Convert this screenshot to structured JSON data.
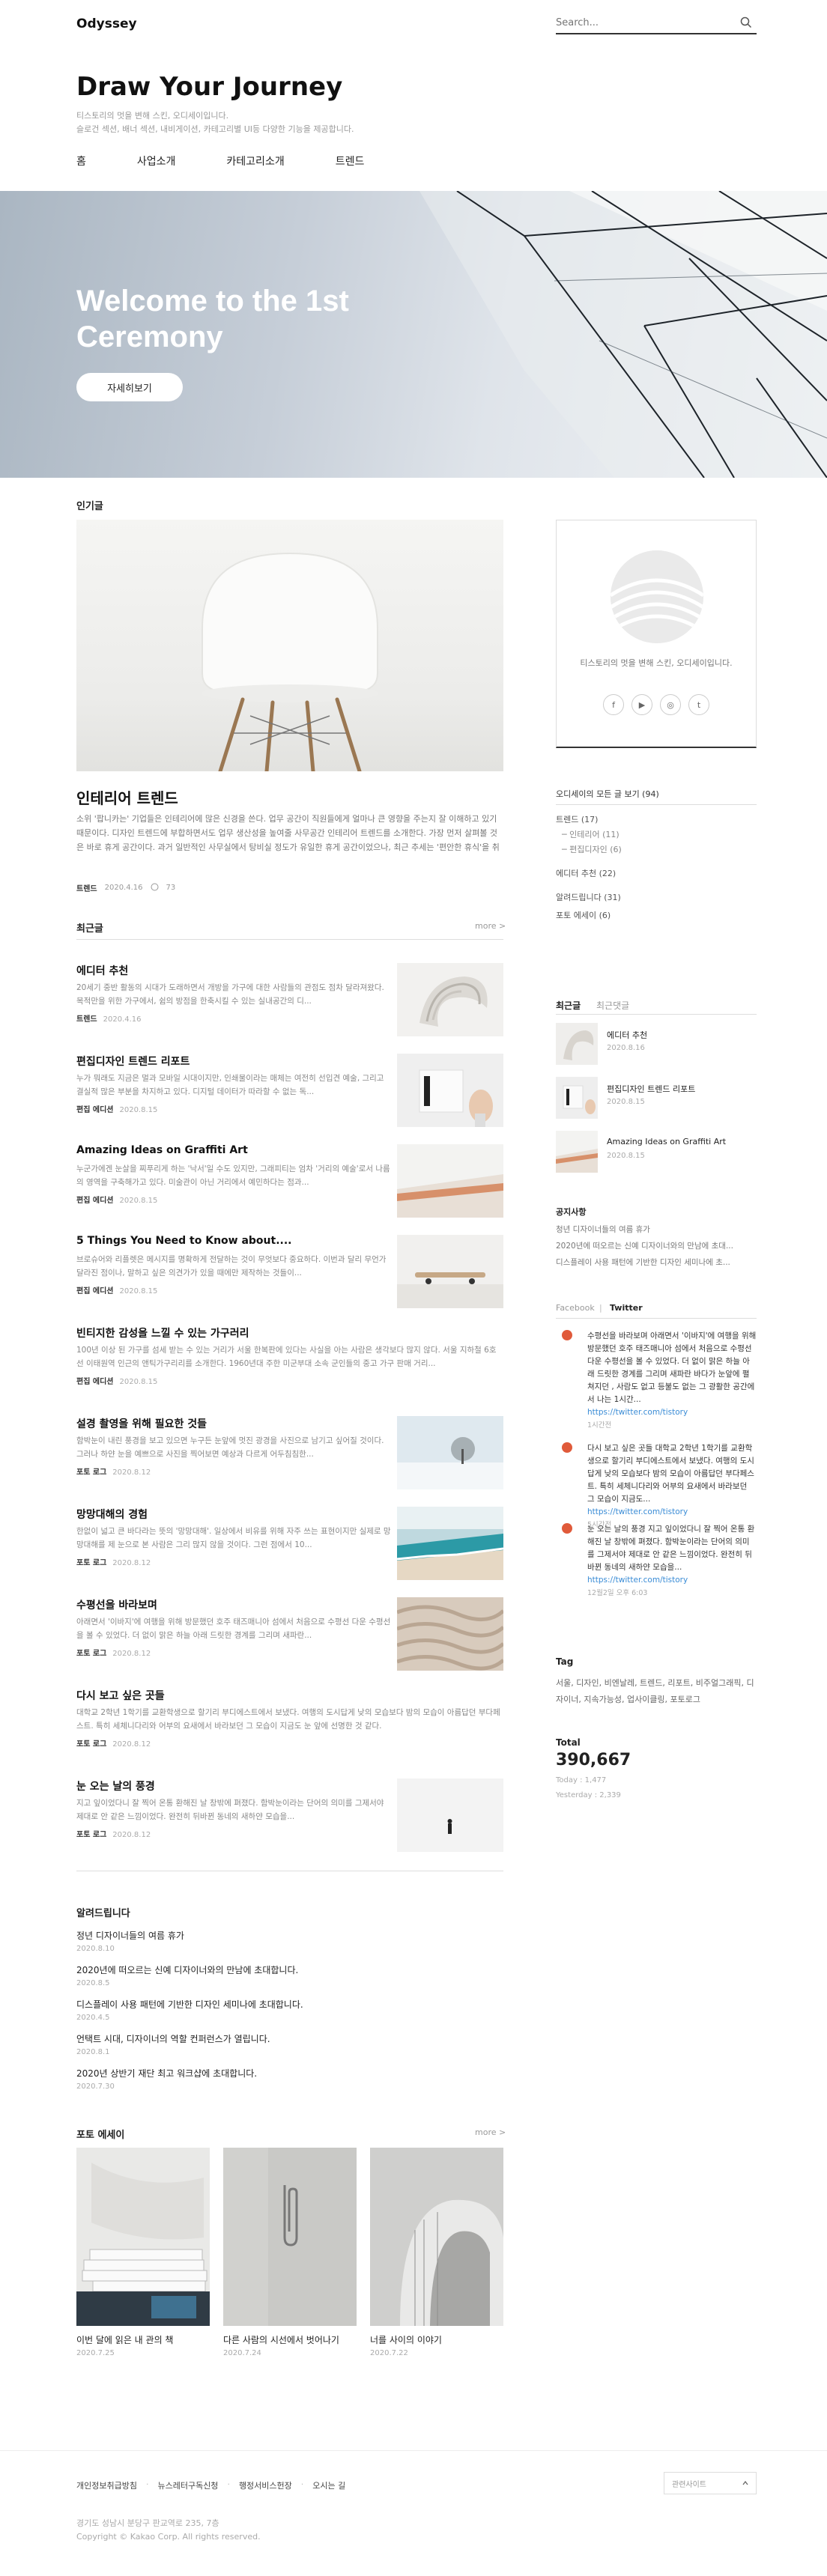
{
  "header": {
    "logo": "Odyssey",
    "search_placeholder": "Search...",
    "blog_title": "Draw Your Journey",
    "blog_desc_1": "티스토리의 멋을 변해 스킨, 오디세이입니다.",
    "blog_desc_2": "슬로건 섹션, 배너 섹션, 내비게이션, 카테고리별 UI등 다양한 기능을 제공합니다.",
    "nav": [
      "홈",
      "사업소개",
      "카테고리소개",
      "트렌드"
    ]
  },
  "hero": {
    "title": "Welcome to the 1st Ceremony",
    "button": "자세히보기"
  },
  "popular": {
    "label": "인기글",
    "title": "인테리어 트렌드",
    "excerpt": "소위 '팝니카는' 기업들은 인테리어에 많은 신경을 쓴다. 업무 공간이 직원들에게 얼마나 큰 영향을 주는지 잘 이해하고 있기 때문이다. 디자인 트렌드에 부합하면서도 업무 생산성을 높여줄 사무공간 인테리어 트렌드를 소개한다. 가장 먼저 살펴볼 것은 바로 휴게 공간이다. 과거 일반적인 사무실에서 탕비실 정도가 유일한 휴게 공간이었으나, 최근 추세는 '편안한 휴식'을 취할 수 있는 공간...",
    "category": "트렌드",
    "date": "2020.4.16",
    "comments": "73"
  },
  "recent": {
    "label": "최근글",
    "more": "more >",
    "posts": [
      {
        "title": "에디터 추천",
        "excerpt": "20세기 중반 활동의 시대가 도래하면서 개방을 가구에 대한 사람들의 관점도 점차 달라져왔다. 목적만을 위한 가구에서, 쉼의 방점을 한축시킬 수 있는 실내공간의 디...",
        "category": "트렌드",
        "date": "2020.4.16"
      },
      {
        "title": "편집디자인 트렌드 리포트",
        "excerpt": "누가 뭐래도 지금은 멀과 모바일 시대이지만, 인쇄물이라는 매체는 여전히 선입견 예술, 그리고 결실적 많은 부분을 차지하고 있다. 디지털 데이터가 따라할 수 없는 독...",
        "category": "편집 에디션",
        "date": "2020.8.15"
      },
      {
        "title": "Amazing Ideas on Graffiti Art",
        "excerpt": "누군가에겐 눈살을 찌푸리게 하는 '낙서'일 수도 있지만, 그래피티는 엄차 '거리의 예술'로서 나름의 영역을 구축해가고 있다. 미술관이 아닌 거리에서 예민하다는 점과...",
        "category": "편집 에디션",
        "date": "2020.8.15"
      },
      {
        "title": "5 Things You Need to Know about....",
        "excerpt": "브로슈어와 리플렛은 메시지를 명확하게 전달하는 것이 무엇보다 중요하다. 이번과 달리 무언가 달라진 점이나, 말하고 싶은 의견가가 있을 때에만 제작하는 것들이...",
        "category": "편집 에디션",
        "date": "2020.8.15"
      },
      {
        "title": "빈티지한 감성을 느낄 수 있는 가구러리",
        "excerpt": "100년 이상 된 가구를 섬세 받는 수 있는 거리가 서울 한복판에 있다는 사실을 아는 사람은 생각보다 많지 않다. 서울 지하철 6호선 이태원역 인근의 앤틱가구리리를 소개한다. 1960년대 주한 미군부대 소속 군인들의 중고 가구 판매 거리...",
        "category": "편집 에디션",
        "date": "2020.8.15"
      },
      {
        "title": "설경 촬영을 위해 필요한 것들",
        "excerpt": "함박눈이 내린 풍경을 보고 있으면 누구든 눈앞에 멋진 광경을 사진으로 남기고 싶어질 것이다. 그러나 하얀 눈을 예쁘으로 사진을 찍어보면 예상과 다르게 어두침침한...",
        "category": "포토 로그",
        "date": "2020.8.12"
      },
      {
        "title": "망망대해의 경험",
        "excerpt": "한없이 넓고 큰 바다라는 뜻의 '망망대해'. 일상에서 비유를 위해 자주 쓰는 표현이지만 실제로 망망대해를 제 눈으로 본 사람은 그리 많지 않을 것이다. 그런 점에서 10...",
        "category": "포토 로그",
        "date": "2020.8.12"
      },
      {
        "title": "수평선을 바라보며",
        "excerpt": "아래면서 '이바지'에 여행을 위해 방문했던 호주 태즈매니아 섬에서 처음으로 수평선 다운 수평선을 볼 수 있었다. 더 없이 맑은 하늘 아래 드릿한 경계를 그리며 새파란...",
        "category": "포토 로그",
        "date": "2020.8.12"
      },
      {
        "title": "다시 보고 싶은 곳들",
        "excerpt": "대학교 2학년 1학기를 교환학생으로 할기리 부디에스트에서 보냈다. 여행의 도시답게 낮의 모습보다 밤의 모습이 아름답던 부다페스트. 특히 세체니다리와 어부의 요새에서 바라보던 그 모습이 지금도 눈 앞에 선명한 것 같다.",
        "category": "포토 로그",
        "date": "2020.8.12"
      },
      {
        "title": "눈 오는 날의 풍경",
        "excerpt": "지고 잎이었다니 잘 찍어 온통 환해진 날 창밖에 펴졌다. 함박눈이라는 단어의 의미를 그제서야 제대로 안 같은 느낌이었다. 완전히 뒤바뀐 동네의 새하얀 모습을...",
        "category": "포토 로그",
        "date": "2020.8.12"
      }
    ]
  },
  "notices": {
    "label": "알려드립니다",
    "items": [
      {
        "title": "정년 디자이너들의 여름 휴가",
        "date": "2020.8.10"
      },
      {
        "title": "2020년에 떠오르는 신예 디자이너와의 만남에 초대합니다.",
        "date": "2020.8.5"
      },
      {
        "title": "디스플레이 사용 패턴에 기반한 디자인 세미나에 초대합니다.",
        "date": "2020.4.5"
      },
      {
        "title": "언택트 시대, 디자이너의 역할 컨퍼런스가 열립니다.",
        "date": "2020.8.1"
      },
      {
        "title": "2020년 상반기 재단 최고 워크샵에 초대합니다.",
        "date": "2020.7.30"
      }
    ]
  },
  "photo_essay": {
    "label": "포토 에세이",
    "more": "more >",
    "items": [
      {
        "title": "이번 달에 읽은 내 관의 책",
        "date": "2020.7.25"
      },
      {
        "title": "다른 사람의 시선에서 벗어나기",
        "date": "2020.7.24"
      },
      {
        "title": "너를 사이의 이야기",
        "date": "2020.7.22"
      }
    ]
  },
  "sidebar": {
    "profile_desc": "티스토리의 멋을 변해 스킨, 오디세이입니다.",
    "social": [
      "f",
      "▶",
      "◎",
      "t"
    ],
    "category_head": "오디세이의 모든 글 보기 (94)",
    "categories": [
      {
        "label": "트렌드 (17)",
        "sub": false
      },
      {
        "label": "─ 인테리어 (11)",
        "sub": true
      },
      {
        "label": "─ 편집디자인 (6)",
        "sub": true
      },
      {
        "label": "에디터 추천 (22)",
        "sub": false
      },
      {
        "label": "알려드립니다 (31)",
        "sub": false
      },
      {
        "label": "포토 에세이 (6)",
        "sub": false
      }
    ],
    "tab_recent": "최근글",
    "tab_comments": "최근댓글",
    "mini_posts": [
      {
        "title": "에디터 추천",
        "date": "2020.8.16"
      },
      {
        "title": "편집디자인 트렌드 리포트",
        "date": "2020.8.15"
      },
      {
        "title": "Amazing Ideas on Graffiti Art",
        "date": "2020.8.15"
      }
    ],
    "notice_label": "공지사항",
    "notices": [
      "청년 디자이너들의 여름 휴가",
      "2020년에 떠오르는 신예 디자이너와의 만남에 초대...",
      "디스플레이 사용 패턴에 기반한 디자인 세미나에 초..."
    ],
    "tab_facebook": "Facebook",
    "tab_twitter": "Twitter",
    "tweets": [
      {
        "text": "수평선을 바라보며 아래면서 '이바지'에 여행을 위해 방문했던 호주 태즈매니아 섬에서 처음으로 수평선 다운 수평선을 볼 수 있었다. 더 없이 맑은 하늘 아래 드릿한 경계를 그리며 새파란 바다가 눈앞에 펼쳐지던 , 사람도 없고 등불도 없는 그 광활한 공간에서 나는 1시간...",
        "link": "https://twitter.com/tistory",
        "time": "1시간전"
      },
      {
        "text": "다시 보고 싶은 곳들 대학교 2학년 1학기를 교환학생으로 할기리 부디에스트에서 보냈다. 여행의 도시답게 낮의 모습보다 밤의 모습이 아름답던 부다페스트. 특히 세체니다리와 어부의 요새에서 바라보던 그 모습이 지금도...",
        "link": "https://twitter.com/tistory",
        "time": "5시간전"
      },
      {
        "text": "눈 오는 날의 풍경 지고 잎이었다니 잘 찍어 온통 환해진 날 창밖에 펴졌다. 함박눈이라는 단어의 의미를 그제서야 제대로 안 같은 느낌이었다. 완전히 뒤바뀐 동네의 새하얀 모습을...",
        "link": "https://twitter.com/tistory",
        "time": "12월2일 오후 6:03"
      }
    ],
    "tag_label": "Tag",
    "tags": "서울, 디자인, 비엔날레, 트렌드, 리포트, 비주얼그래픽, 디자이너, 지속가능성, 업사이클링, 포토로그",
    "total_label": "Total",
    "total_count": "390,667",
    "today": "Today : 1,477",
    "yesterday": "Yesterday : 2,339"
  },
  "footer": {
    "links": [
      "개인정보취급방침",
      "뉴스레터구독신청",
      "행정서비스헌장",
      "오시는 길"
    ],
    "family": "관련사이트",
    "address": "경기도 성남시 분당구 판교역로 235, 7층",
    "copyright": "Copyright © Kakao Corp. All rights reserved."
  }
}
